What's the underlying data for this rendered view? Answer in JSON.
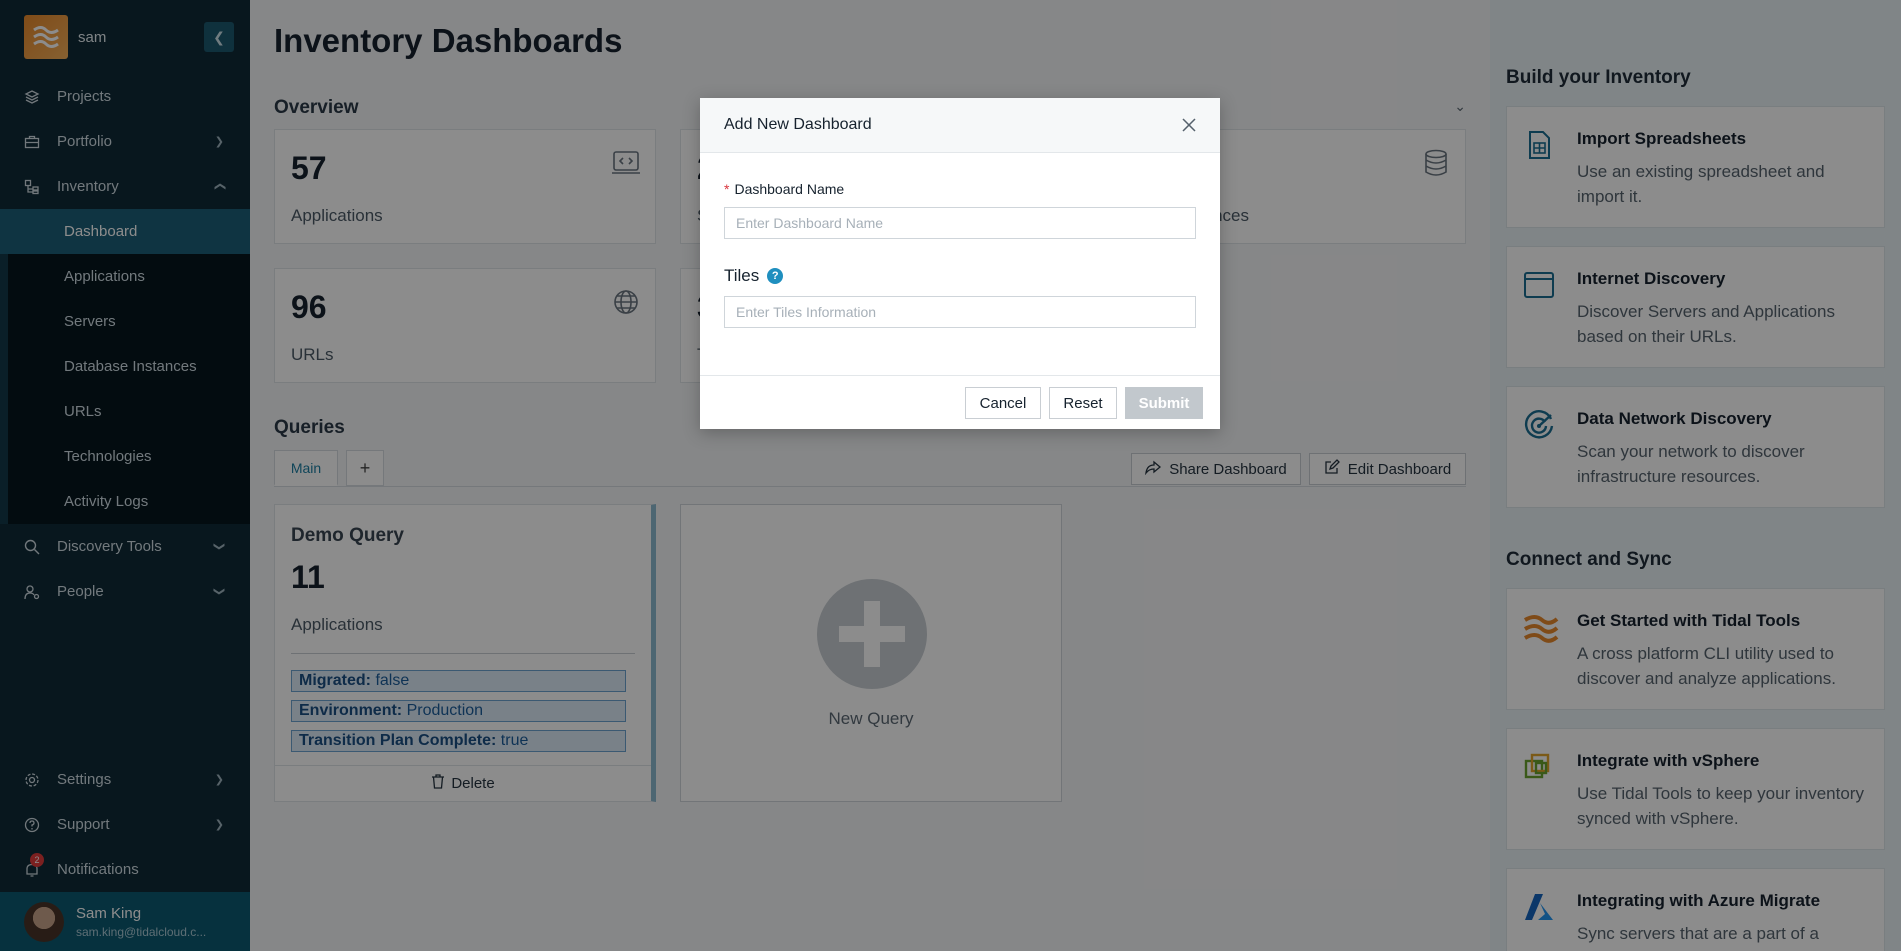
{
  "sidebar": {
    "user": "sam",
    "collapse_icon": "chevron-left-icon",
    "items": [
      {
        "label": "Projects",
        "icon": "layers-icon"
      },
      {
        "label": "Portfolio",
        "icon": "briefcase-icon"
      },
      {
        "label": "Inventory",
        "icon": "inventory-icon"
      }
    ],
    "inventory_sub": [
      {
        "label": "Dashboard"
      },
      {
        "label": "Applications"
      },
      {
        "label": "Servers"
      },
      {
        "label": "Database Instances"
      },
      {
        "label": "URLs"
      },
      {
        "label": "Technologies"
      },
      {
        "label": "Activity Logs"
      }
    ],
    "discovery": "Discovery Tools",
    "people": "People",
    "settings": "Settings",
    "support": "Support",
    "notifications": "Notifications",
    "notifications_count": "2",
    "profile_name": "Sam King",
    "profile_email": "sam.king@tidalcloud.c..."
  },
  "main": {
    "title": "Inventory Dashboards",
    "overview": "Overview",
    "cards": [
      {
        "num": "57",
        "label": "Applications",
        "icon": "code-window-icon"
      },
      {
        "num": "96",
        "label": "URLs",
        "icon": "globe-icon"
      }
    ],
    "partial_cards": {
      "top_mid_num": "2",
      "top_mid_lbl": "S",
      "bot_mid_num": "3",
      "bot_mid_lbl": "T",
      "top_right_lbl": "nces"
    },
    "queries": "Queries",
    "tab_main": "Main",
    "tab_add": "+",
    "share_label": "Share Dashboard",
    "edit_label": "Edit Dashboard",
    "query": {
      "title": "Demo Query",
      "num": "11",
      "label": "Applications",
      "tags": [
        {
          "key": "Migrated:",
          "value": " false"
        },
        {
          "key": "Environment:",
          "value": " Production"
        },
        {
          "key": "Transition Plan Complete:",
          "value": " true"
        }
      ],
      "delete": "Delete"
    },
    "new_query": "New Query"
  },
  "right": {
    "build_title": "Build your Inventory",
    "build": [
      {
        "title": "Import Spreadsheets",
        "desc": "Use an existing spreadsheet and import it."
      },
      {
        "title": "Internet Discovery",
        "desc": "Discover Servers and Applications based on their URLs."
      },
      {
        "title": "Data Network Discovery",
        "desc": "Scan your network to discover infrastructure resources."
      }
    ],
    "sync_title": "Connect and Sync",
    "sync": [
      {
        "title": "Get Started with Tidal Tools",
        "desc": "A cross platform CLI utility used to discover and analyze applications."
      },
      {
        "title": "Integrate with vSphere",
        "desc": "Use Tidal Tools to keep your inventory synced with vSphere."
      },
      {
        "title": "Integrating with Azure Migrate",
        "desc": "Sync servers that are a part of a Project"
      }
    ]
  },
  "modal": {
    "title": "Add New Dashboard",
    "name_label": "Dashboard Name",
    "required_mark": "*",
    "name_placeholder": "Enter Dashboard Name",
    "tiles_label": "Tiles",
    "tiles_placeholder": "Enter Tiles Information",
    "cancel": "Cancel",
    "reset": "Reset",
    "submit": "Submit"
  }
}
